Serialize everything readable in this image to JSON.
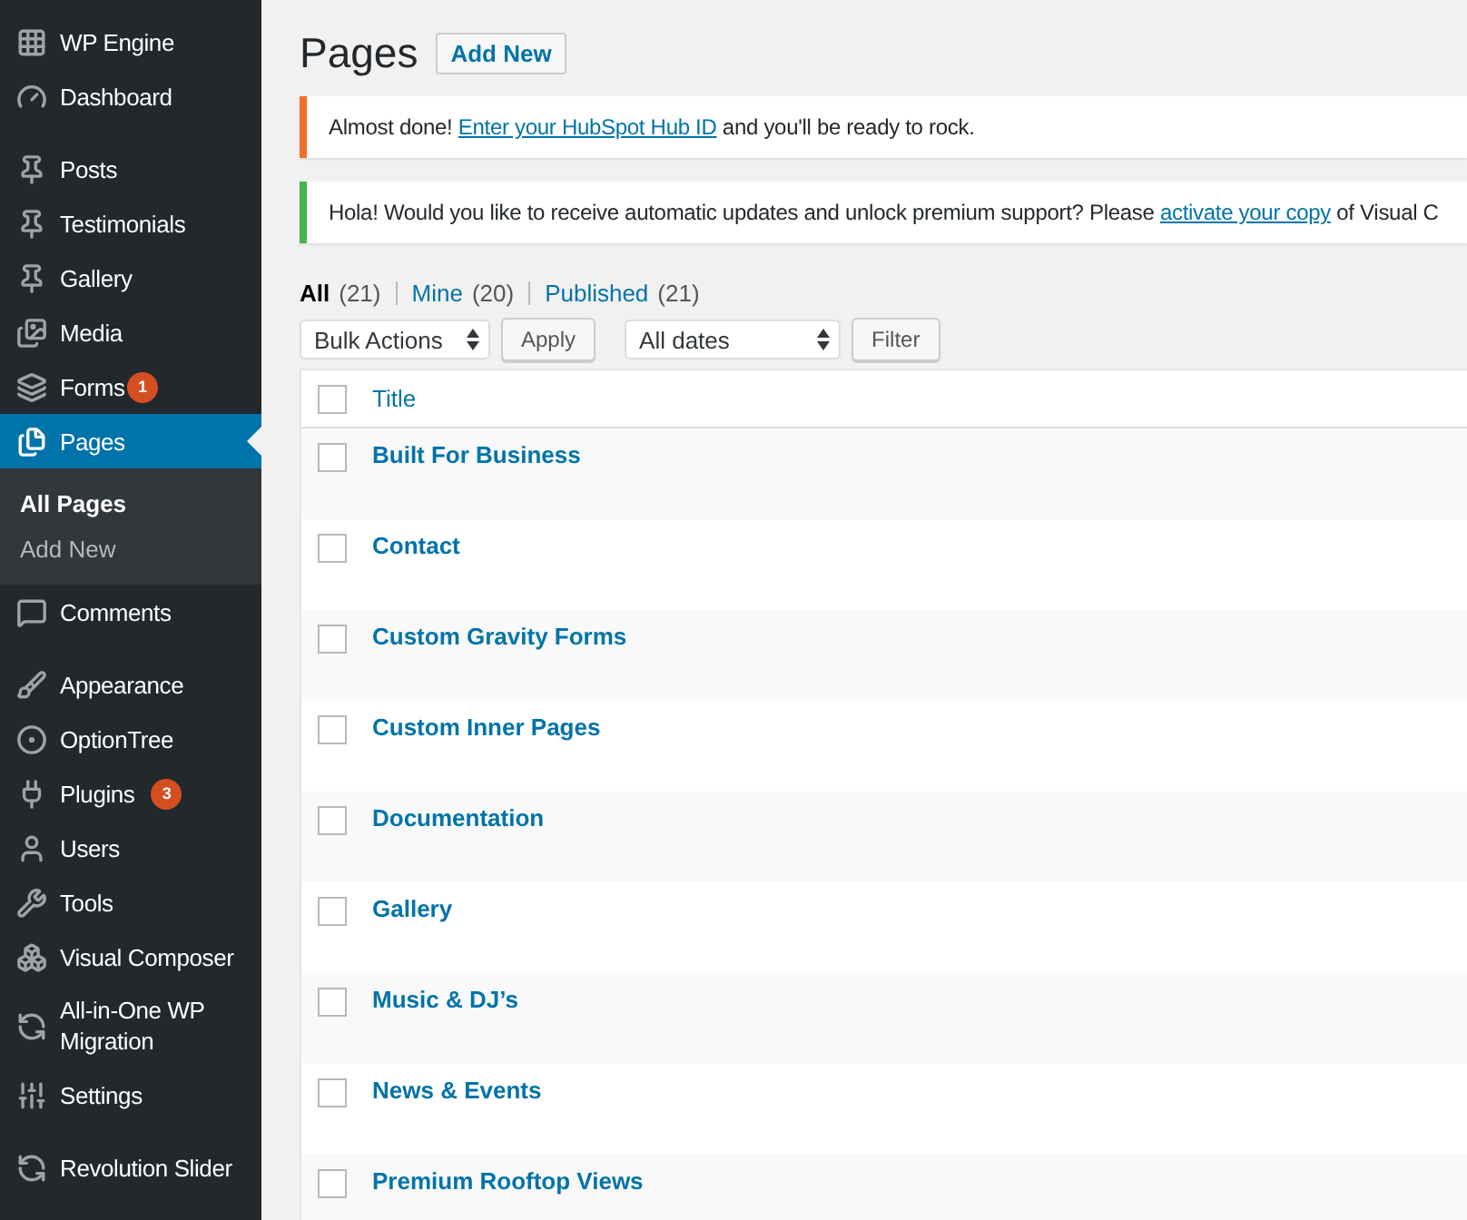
{
  "sidebar": {
    "groups": [
      {
        "items": [
          {
            "label": "WP Engine",
            "selected": false
          },
          {
            "label": "Dashboard",
            "selected": false
          }
        ]
      },
      {
        "items": [
          {
            "label": "Posts",
            "selected": false
          },
          {
            "label": "Testimonials",
            "selected": false
          },
          {
            "label": "Gallery",
            "selected": false
          },
          {
            "label": "Media",
            "selected": false
          },
          {
            "label": "Forms",
            "selected": false,
            "badge": "1"
          },
          {
            "label": "Pages",
            "selected": true,
            "children": [
              {
                "label": "All Pages",
                "selected": true
              },
              {
                "label": "Add New",
                "selected": false
              }
            ]
          },
          {
            "label": "Comments",
            "selected": false
          }
        ]
      },
      {
        "items": [
          {
            "label": "Appearance",
            "selected": false
          },
          {
            "label": "OptionTree",
            "selected": false
          },
          {
            "label": "Plugins",
            "selected": false,
            "badge": "3"
          },
          {
            "label": "Users",
            "selected": false
          },
          {
            "label": "Tools",
            "selected": false
          },
          {
            "label": "Visual Composer",
            "selected": false
          },
          {
            "label": "All-in-One WP Migration",
            "selected": false
          },
          {
            "label": "Settings",
            "selected": false
          }
        ]
      },
      {
        "items": [
          {
            "label": "Revolution Slider",
            "selected": false
          }
        ]
      }
    ]
  },
  "header": {
    "title": "Pages",
    "button": "Add New"
  },
  "notices": [
    {
      "kind": "warning",
      "before": "Almost done! ",
      "link": "Enter your HubSpot Hub ID",
      "after": " and you'll be ready to rock."
    },
    {
      "kind": "success",
      "before": "Hola! Would you like to receive automatic updates and unlock premium support? Please ",
      "link": "activate your copy",
      "after": " of Visual C"
    }
  ],
  "filters": [
    {
      "label": "All",
      "count": "(21)",
      "selected": true
    },
    {
      "label": "Mine",
      "count": "(20)",
      "selected": false
    },
    {
      "label": "Published",
      "count": "(21)",
      "selected": false
    }
  ],
  "actions": {
    "bulk": "Bulk Actions",
    "apply": "Apply",
    "dates": "All dates",
    "filter": "Filter"
  },
  "table": {
    "columns": [
      "Title"
    ],
    "header_checked": false,
    "rows": [
      {
        "title": "Built For Business",
        "checked": false
      },
      {
        "title": "Contact",
        "checked": false
      },
      {
        "title": "Custom Gravity Forms",
        "checked": false
      },
      {
        "title": "Custom Inner Pages",
        "checked": false
      },
      {
        "title": "Documentation",
        "checked": false
      },
      {
        "title": "Gallery",
        "checked": false
      },
      {
        "title": "Music & DJ’s",
        "checked": false
      },
      {
        "title": "News & Events",
        "checked": false
      },
      {
        "title": "Premium Rooftop Views",
        "checked": false
      }
    ]
  }
}
